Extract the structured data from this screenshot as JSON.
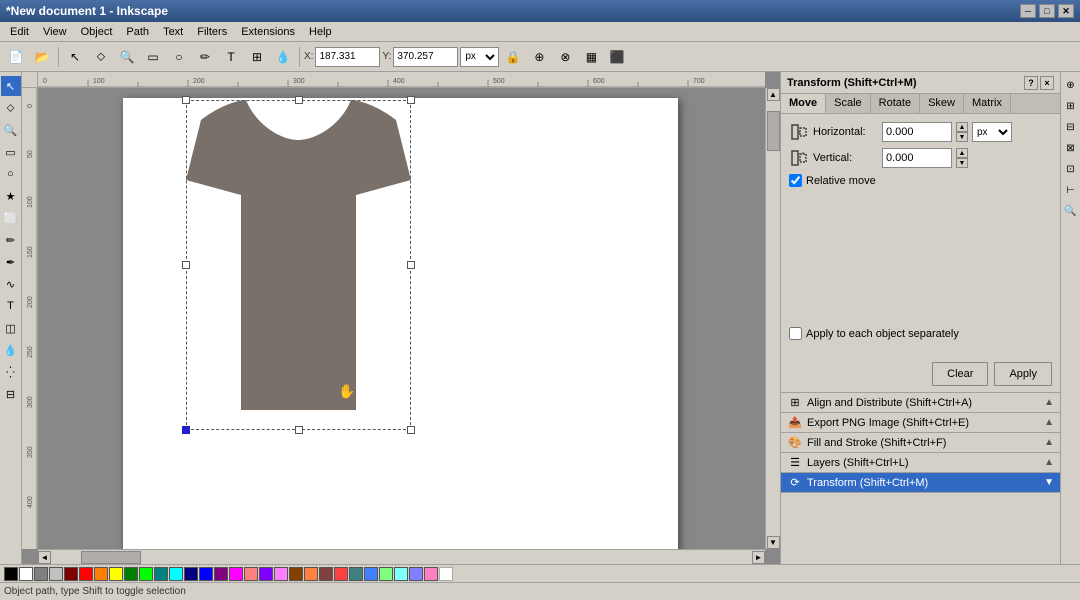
{
  "window": {
    "title": "*New document 1 - Inkscape",
    "minimize_label": "─",
    "restore_label": "□",
    "close_label": "✕"
  },
  "menubar": {
    "items": [
      "Edit",
      "View",
      "Object",
      "Path",
      "Text",
      "Filters",
      "Extensions",
      "Help"
    ]
  },
  "toolbar": {
    "x_label": "X:",
    "x_value": "187.331",
    "y_label": "Y:",
    "y_value": "370.257",
    "unit": "px"
  },
  "transform_panel": {
    "title": "Transform (Shift+Ctrl+M)",
    "tabs": [
      "Move",
      "Scale",
      "Rotate",
      "Skew",
      "Matrix"
    ],
    "active_tab": "Move",
    "horizontal_label": "Horizontal:",
    "horizontal_value": "0.000",
    "vertical_label": "Vertical:",
    "vertical_value": "0.000",
    "unit": "px",
    "relative_move_label": "Relative move",
    "relative_move_checked": true,
    "apply_each_label": "Apply to each object separately",
    "apply_each_checked": false,
    "clear_label": "Clear",
    "apply_label": "Apply"
  },
  "bottom_panels": [
    {
      "label": "Align and Distribute (Shift+Ctrl+A)",
      "active": false
    },
    {
      "label": "Export PNG Image (Shift+Ctrl+E)",
      "active": false
    },
    {
      "label": "Fill and Stroke (Shift+Ctrl+F)",
      "active": false
    },
    {
      "label": "Layers (Shift+Ctrl+L)",
      "active": false
    },
    {
      "label": "Transform (Shift+Ctrl+M)",
      "active": true
    }
  ],
  "colors": {
    "swatches": [
      "#000000",
      "#ffffff",
      "#808080",
      "#c0c0c0",
      "#800000",
      "#ff0000",
      "#ff8000",
      "#ffff00",
      "#008000",
      "#00ff00",
      "#008080",
      "#00ffff",
      "#000080",
      "#0000ff",
      "#800080",
      "#ff00ff",
      "#ff8080",
      "#8000ff",
      "#ff80ff",
      "#804000",
      "#ff8040",
      "#804040",
      "#ff4040",
      "#408080",
      "#4080ff",
      "#80ff80",
      "#80ffff",
      "#8080ff",
      "#ff80c0",
      "#ffffff"
    ]
  },
  "tshirt": {
    "color": "#7a706a"
  },
  "status": {
    "text": "Object path, type Shift to toggle selection"
  }
}
